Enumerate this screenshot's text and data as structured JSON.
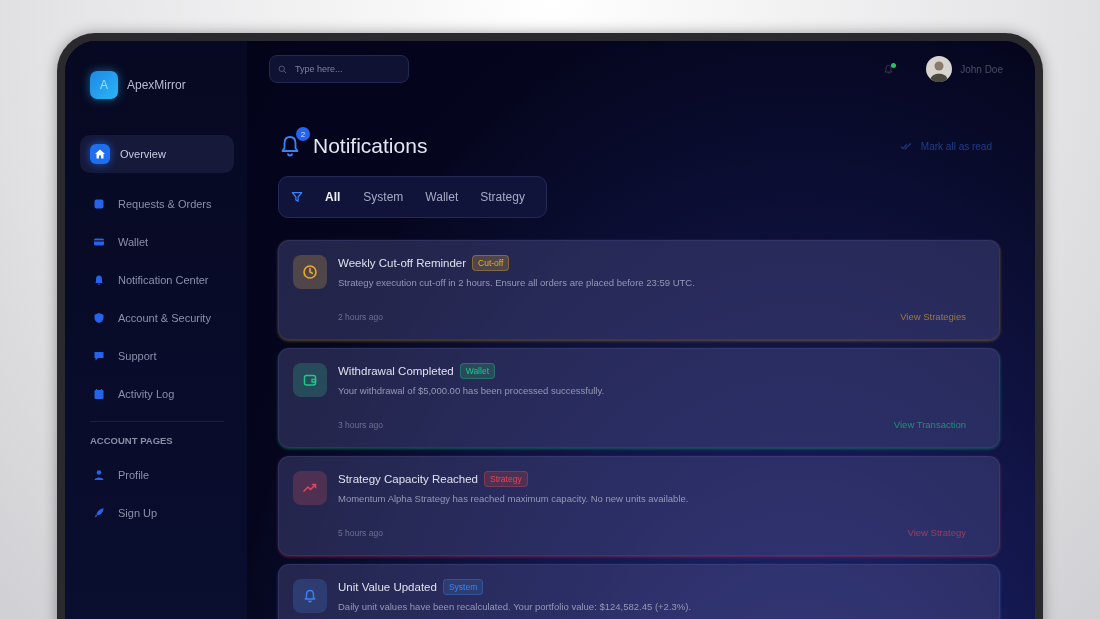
{
  "brand": {
    "letter": "A",
    "name": "ApexMirror"
  },
  "sidebar": {
    "items": [
      {
        "label": "Overview",
        "selected": true
      },
      {
        "label": "Requests & Orders",
        "selected": false
      },
      {
        "label": "Wallet",
        "selected": false
      },
      {
        "label": "Notification Center",
        "selected": false
      },
      {
        "label": "Account & Security",
        "selected": false
      },
      {
        "label": "Support",
        "selected": false
      },
      {
        "label": "Activity Log",
        "selected": false
      }
    ],
    "section_title": "ACCOUNT PAGES",
    "account_items": [
      {
        "label": "Profile",
        "selected": false
      },
      {
        "label": "Sign Up",
        "selected": false
      }
    ]
  },
  "search": {
    "placeholder": "Type here..."
  },
  "topbar": {
    "alert": true,
    "user_name": "John Doe"
  },
  "header": {
    "title": "Notifications",
    "badge": "2",
    "mark_all": "Mark all as read"
  },
  "tabs": [
    {
      "label": "All",
      "selected": true
    },
    {
      "label": "System",
      "selected": false
    },
    {
      "label": "Wallet",
      "selected": false
    },
    {
      "label": "Strategy",
      "selected": false
    }
  ],
  "notifications": [
    {
      "kind": "cutoff",
      "title": "Weekly Cut-off Reminder",
      "tag": "Cut-off",
      "message": "Strategy execution cut-off in 2 hours. Ensure all orders are placed before 23:59 UTC.",
      "time": "2 hours ago",
      "action": "View Strategies"
    },
    {
      "kind": "wallet",
      "title": "Withdrawal Completed",
      "tag": "Wallet",
      "message": "Your withdrawal of $5,000.00 has been processed successfully.",
      "time": "3 hours ago",
      "action": "View Transaction"
    },
    {
      "kind": "strategy",
      "title": "Strategy Capacity Reached",
      "tag": "Strategy",
      "message": "Momentum Alpha Strategy has reached maximum capacity. No new units available.",
      "time": "5 hours ago",
      "action": "View Strategy"
    },
    {
      "kind": "system",
      "title": "Unit Value Updated",
      "tag": "System",
      "message": "Daily unit values have been recalculated. Your portfolio value: $124,582.45 (+2.3%)."
    }
  ]
}
